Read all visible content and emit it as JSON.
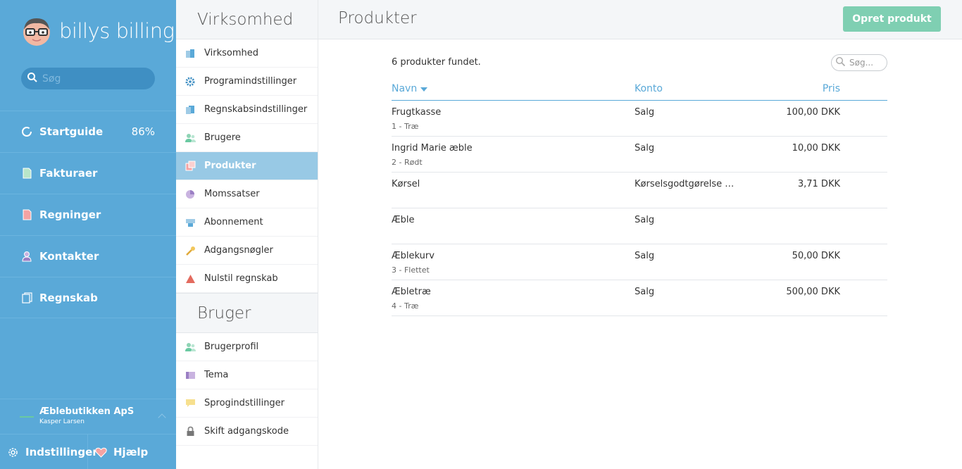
{
  "app": {
    "logo_text": "billys billing"
  },
  "leftnav": {
    "search_placeholder": "Søg",
    "items": [
      {
        "label": "Startguide",
        "icon": "progress-ring-icon",
        "badge": "86%"
      },
      {
        "label": "Fakturaer",
        "icon": "invoice-icon"
      },
      {
        "label": "Regninger",
        "icon": "bill-icon"
      },
      {
        "label": "Kontakter",
        "icon": "contact-icon"
      },
      {
        "label": "Regnskab",
        "icon": "ledger-icon"
      }
    ],
    "org_name": "Æblebutikken ApS",
    "org_user": "Kasper Larsen",
    "settings_label": "Indstillinger",
    "help_label": "Hjælp"
  },
  "settings": {
    "company_heading": "Virksomhed",
    "company_items": [
      {
        "label": "Virksomhed",
        "icon": "building-icon"
      },
      {
        "label": "Programindstillinger",
        "icon": "gear-icon"
      },
      {
        "label": "Regnskabsindstillinger",
        "icon": "ledger-settings-icon"
      },
      {
        "label": "Brugere",
        "icon": "users-icon"
      },
      {
        "label": "Produkter",
        "icon": "products-icon",
        "active": true
      },
      {
        "label": "Momssatser",
        "icon": "pie-icon"
      },
      {
        "label": "Abonnement",
        "icon": "subscription-icon"
      },
      {
        "label": "Adgangsnøgler",
        "icon": "key-icon"
      },
      {
        "label": "Nulstil regnskab",
        "icon": "warning-icon"
      }
    ],
    "user_heading": "Bruger",
    "user_items": [
      {
        "label": "Brugerprofil",
        "icon": "user-profile-icon"
      },
      {
        "label": "Tema",
        "icon": "theme-icon"
      },
      {
        "label": "Sprogindstillinger",
        "icon": "speech-bubble-icon"
      },
      {
        "label": "Skift adgangskode",
        "icon": "lock-icon"
      }
    ]
  },
  "main": {
    "title": "Produkter",
    "create_button": "Opret produkt",
    "found_text": "6 produkter fundet.",
    "search_placeholder": "Søg...",
    "columns": {
      "name": "Navn",
      "account": "Konto",
      "price": "Pris"
    },
    "rows": [
      {
        "name": "Frugtkasse",
        "sub": "1 - Træ",
        "account": "Salg",
        "price": "100,00 DKK"
      },
      {
        "name": "Ingrid Marie æble",
        "sub": "2 - Rødt",
        "account": "Salg",
        "price": "10,00 DKK"
      },
      {
        "name": "Kørsel",
        "sub": "",
        "account": "Kørselsgodtgørelse …",
        "price": "3,71 DKK"
      },
      {
        "name": "Æble",
        "sub": "",
        "account": "Salg",
        "price": ""
      },
      {
        "name": "Æblekurv",
        "sub": "3 - Flettet",
        "account": "Salg",
        "price": "50,00 DKK"
      },
      {
        "name": "Æbletræ",
        "sub": "4 - Træ",
        "account": "Salg",
        "price": "500,00 DKK"
      }
    ]
  },
  "colors": {
    "sidebar": "#5aa9d8",
    "accent": "#7fcfb2",
    "active_item": "#98c9e5"
  }
}
